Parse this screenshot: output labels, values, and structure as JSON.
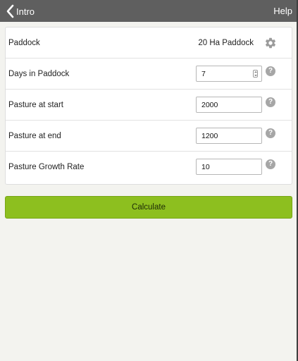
{
  "header": {
    "back_label": "Intro",
    "help_label": "Help"
  },
  "form": {
    "paddock": {
      "label": "Paddock",
      "value": "20 Ha Paddock"
    },
    "days": {
      "label": "Days in Paddock",
      "value": "7",
      "help": "?"
    },
    "pasture_start": {
      "label": "Pasture at start",
      "value": "2000",
      "help": "?"
    },
    "pasture_end": {
      "label": "Pasture at end",
      "value": "1200",
      "help": "?"
    },
    "growth_rate": {
      "label": "Pasture Growth Rate",
      "value": "10",
      "help": "?"
    }
  },
  "actions": {
    "calculate_label": "Calculate"
  },
  "colors": {
    "topbar": "#5f5f5f",
    "accent_green": "#8dbf1f",
    "background": "#f3f3ef"
  }
}
